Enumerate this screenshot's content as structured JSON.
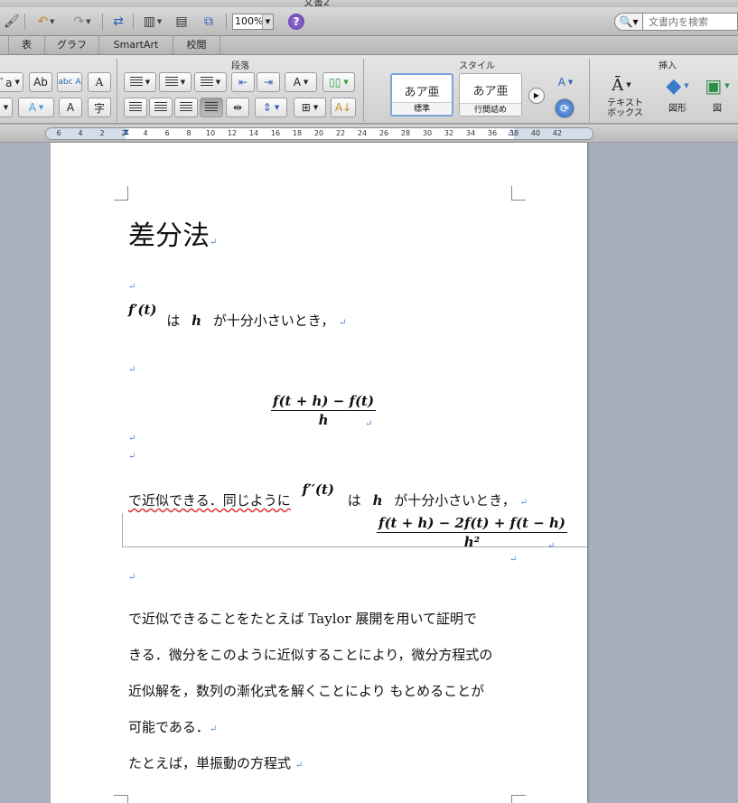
{
  "window": {
    "title": "文書2"
  },
  "toolbar": {
    "zoom": "100%",
    "help": "?",
    "search_placeholder": "文書内を検索"
  },
  "ribbon_tabs": [
    "",
    "表",
    "グラフ",
    "SmartArt",
    "校閲"
  ],
  "ribbon": {
    "groups": {
      "paragraph": "段落",
      "styles": "スタイル",
      "insert": "挿入"
    },
    "styles": [
      {
        "sample": "あア亜",
        "name": "標準"
      },
      {
        "sample": "あア亜",
        "name": "行間詰め"
      }
    ],
    "insert": {
      "textbox": "テキスト\nボックス",
      "shapes": "図形",
      "picture": "図"
    },
    "font_buttons": [
      "ﾞa",
      "Ab",
      "abc A",
      "A",
      "A",
      "A",
      "字"
    ]
  },
  "ruler": {
    "ticks": [
      "6",
      "4",
      "2",
      "2",
      "4",
      "6",
      "8",
      "10",
      "12",
      "14",
      "16",
      "18",
      "20",
      "22",
      "24",
      "26",
      "28",
      "30",
      "32",
      "34",
      "36",
      "38",
      "40",
      "42"
    ]
  },
  "document": {
    "heading": "差分法",
    "pilcrow": "↵",
    "line1": {
      "math": "f′(t)",
      "text_a": "は",
      "h": "h",
      "text_b": "が十分小さいとき，"
    },
    "frac1": {
      "num": "f(t + h) − f(t)",
      "den": "h"
    },
    "line2": {
      "lead": "で近似できる．同じように",
      "math": "f′′(t)",
      "text_a": "は",
      "h": "h",
      "text_b": "が十分小さいとき，"
    },
    "frac2": {
      "num": "f(t + h) − 2f(t) + f(t − h)",
      "den": "h²"
    },
    "body": [
      "で近似できることをたとえば Taylor 展開を用いて証明で",
      "きる．微分をこのように近似することにより，微分方程式の",
      "近似解を，数列の漸化式を解くことにより もとめることが",
      "可能である．",
      "たとえば，単振動の方程式"
    ]
  }
}
